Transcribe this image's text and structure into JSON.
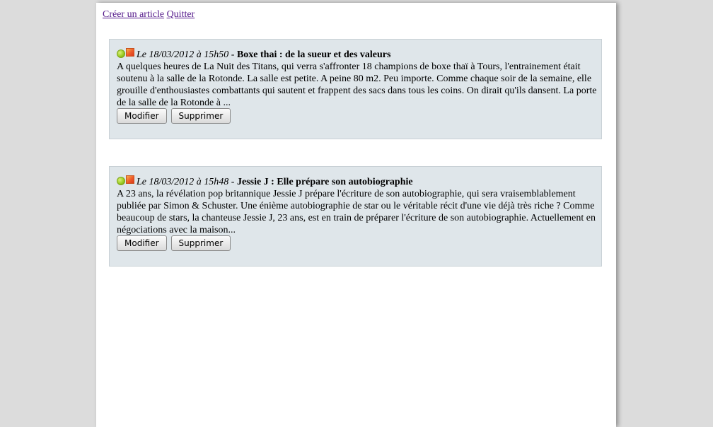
{
  "nav": {
    "create_label": "Créer un article",
    "quit_label": "Quitter"
  },
  "articles": [
    {
      "date": "Le 18/03/2012 à 15h50",
      "separator": " - ",
      "title": "Boxe thai : de la sueur et des valeurs",
      "excerpt": "A quelques heures de La Nuit des Titans, qui verra s'affronter 18 champions de boxe thaï à Tours, l'entrainement était soutenu à la salle de la Rotonde. La salle est petite. A peine 80 m2. Peu importe. Comme chaque soir de la semaine, elle grouille d'enthousiastes combattants qui sautent et frappent des sacs dans tous les coins. On dirait qu'ils dansent. La porte de la salle de la Rotonde à ...",
      "edit_label": "Modifier",
      "delete_label": "Supprimer"
    },
    {
      "date": "Le 18/03/2012 à 15h48",
      "separator": " - ",
      "title": "Jessie J : Elle prépare son autobiographie",
      "excerpt": "A 23 ans, la révélation pop britannique Jessie J prépare l'écriture de son autobiographie, qui sera vraisemblablement publiée par Simon & Schuster. Une énième autobiographie de star ou le véritable récit d'une vie déjà très riche ? Comme beaucoup de stars, la chanteuse Jessie J, 23 ans, est en train de préparer l'écriture de son autobiographie. Actuellement en négociations avec la maison...",
      "edit_label": "Modifier",
      "delete_label": "Supprimer"
    }
  ],
  "icons": {
    "status": "green-status-icon",
    "feed": "rss-feed-icon"
  },
  "colors": {
    "link": "#551a8b",
    "article_bg": "#dfe6ea",
    "page_bg": "#dcdcdc"
  }
}
